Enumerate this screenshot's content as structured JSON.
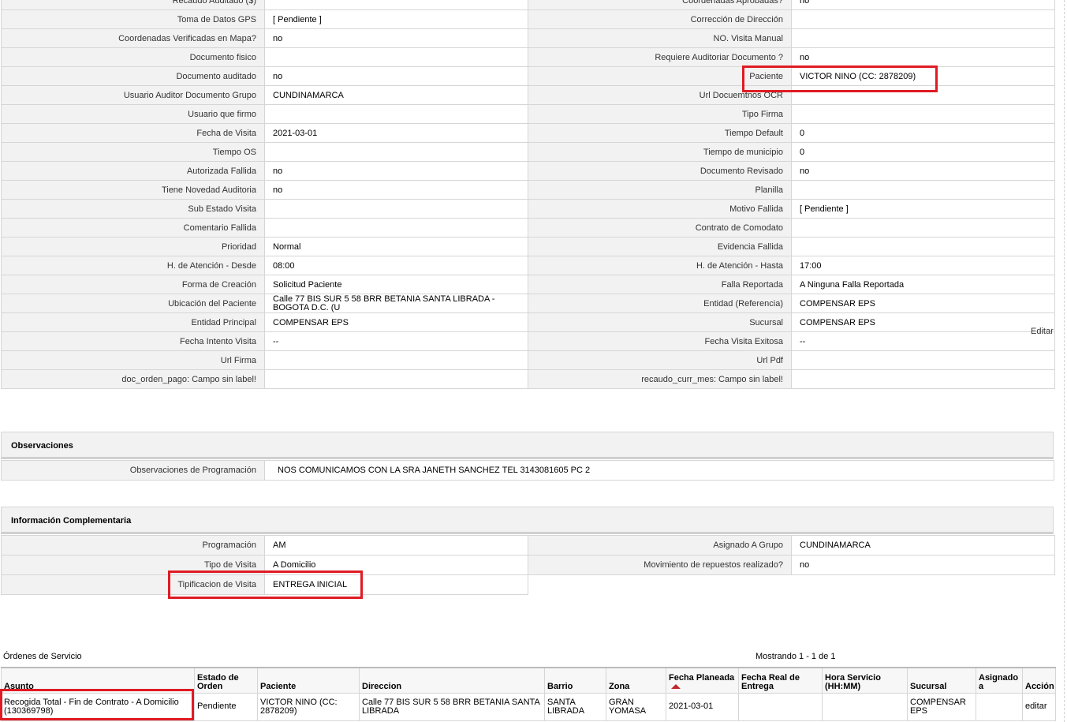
{
  "detail_rows": [
    {
      "l1": "Recaudo Auditado ($)",
      "v1": "",
      "l2": "Coordenadas Aprobadas?",
      "v2": "no"
    },
    {
      "l1": "Toma de Datos GPS",
      "v1": "[ Pendiente ]",
      "l2": "Corrección de Dirección",
      "v2": ""
    },
    {
      "l1": "Coordenadas Verificadas en Mapa?",
      "v1": "no",
      "l2": "NO. Visita Manual",
      "v2": ""
    },
    {
      "l1": "Documento fisico",
      "v1": "",
      "l2": "Requiere Auditoriar Documento ?",
      "v2": "no"
    },
    {
      "l1": "Documento auditado",
      "v1": "no",
      "l2": "Paciente",
      "v2": "VICTOR NINO (CC: 2878209)"
    },
    {
      "l1": "Usuario Auditor Documento Grupo",
      "v1": "CUNDINAMARCA",
      "l2": "Url Docuemtnos OCR",
      "v2": ""
    },
    {
      "l1": "Usuario que firmo",
      "v1": "",
      "l2": "Tipo Firma",
      "v2": ""
    },
    {
      "l1": "Fecha de Visita",
      "v1": "2021-03-01",
      "l2": "Tiempo Default",
      "v2": "0"
    },
    {
      "l1": "Tiempo OS",
      "v1": "",
      "l2": "Tiempo de municipio",
      "v2": "0"
    },
    {
      "l1": "Autorizada Fallida",
      "v1": "no",
      "l2": "Documento Revisado",
      "v2": "no"
    },
    {
      "l1": "Tiene Novedad Auditoria",
      "v1": "no",
      "l2": "Planilla",
      "v2": ""
    },
    {
      "l1": "Sub Estado Visita",
      "v1": "",
      "l2": "Motivo Fallida",
      "v2": "[ Pendiente ]"
    },
    {
      "l1": "Comentario Fallida",
      "v1": "",
      "l2": "Contrato de Comodato",
      "v2": ""
    },
    {
      "l1": "Prioridad",
      "v1": "Normal",
      "l2": "Evidencia Fallida",
      "v2": ""
    },
    {
      "l1": "H. de Atención - Desde",
      "v1": "08:00",
      "l2": "H. de Atención - Hasta",
      "v2": "17:00"
    },
    {
      "l1": "Forma de Creación",
      "v1": "Solicitud Paciente",
      "l2": "Falla Reportada",
      "v2": "A Ninguna Falla Reportada"
    },
    {
      "l1": "Ubicación del Paciente",
      "v1": "Calle 77 BIS SUR 5 58 BRR BETANIA SANTA LIBRADA - BOGOTA D.C. (U",
      "l2": "Entidad (Referencia)",
      "v2": "COMPENSAR EPS"
    },
    {
      "l1": "Entidad Principal",
      "v1": "COMPENSAR EPS",
      "l2": "Sucursal",
      "v2": "COMPENSAR EPS"
    },
    {
      "l1": "Fecha Intento Visita",
      "v1": "--",
      "l2": "Fecha Visita Exitosa",
      "v2": "--"
    },
    {
      "l1": "Url Firma",
      "v1": "",
      "l2": "Url Pdf",
      "v2": ""
    },
    {
      "l1": "doc_orden_pago: Campo sin label!",
      "v1": "",
      "l2": "recaudo_curr_mes: Campo sin label!",
      "v2": ""
    }
  ],
  "edit_label": "Editar",
  "observaciones": {
    "title": "Observaciones",
    "label": "Observaciones de Programación",
    "value": "NOS COMUNICAMOS CON LA SRA JANETH SANCHEZ TEL 3143081605 PC 2"
  },
  "info_complementaria": {
    "title": "Información Complementaria",
    "programacion_label": "Programación",
    "programacion_value": "AM",
    "grupo_label": "Asignado A Grupo",
    "grupo_value": "CUNDINAMARCA",
    "tipo_label": "Tipo de Visita",
    "tipo_value": "A Domicilio",
    "repuestos_label": "Movimiento de repuestos realizado?",
    "repuestos_value": "no",
    "tipificacion_label": "Tipificacion de Visita",
    "tipificacion_value": "ENTREGA INICIAL"
  },
  "orders": {
    "title": "Órdenes de Servicio",
    "count": "Mostrando 1 - 1 de 1",
    "columns": [
      "Asunto",
      "Estado de Orden",
      "Paciente",
      "Direccion",
      "Barrio",
      "Zona",
      "Fecha Planeada",
      "Fecha Real de Entrega",
      "Hora Servicio (HH:MM)",
      "Sucursal",
      "Asignado a",
      "Acción"
    ],
    "rows": [
      [
        "Recogida Total - Fin de Contrato - A Domicilio (130369798)",
        "Pendiente",
        "VICTOR NINO (CC: 2878209)",
        "Calle 77 BIS SUR 5 58 BRR BETANIA SANTA LIBRADA",
        "SANTA LIBRADA",
        "GRAN YOMASA",
        "2021-03-01",
        "",
        "",
        "COMPENSAR EPS",
        "",
        "editar"
      ]
    ]
  },
  "colors": {
    "highlight": "#e01b24",
    "label_bg": "#f2f2f2",
    "border": "#d6d6d6",
    "sort_arrow": "#c0282b"
  }
}
